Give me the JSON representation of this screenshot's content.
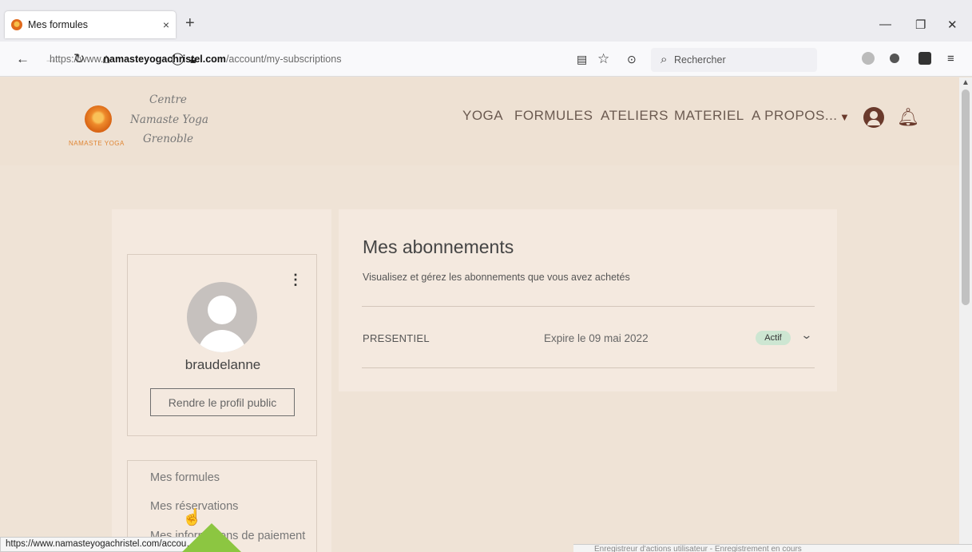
{
  "browser": {
    "tab_title": "Mes formules",
    "tab_close": "×",
    "new_tab": "+",
    "url_prefix": "https://www.",
    "url_domain": "namasteyogachristel.com",
    "url_path": "/account/my-subscriptions",
    "search_placeholder": "Rechercher",
    "status_url": "https://www.namasteyogachristel.com/accou…ings"
  },
  "site": {
    "logo_caption": "NAMASTE YOGA",
    "brand_line1": "Centre",
    "brand_line2": "Namaste Yoga",
    "brand_line3": "Grenoble",
    "nav": [
      "YOGA",
      "FORMULES",
      "ATELIERS",
      "MATERIEL",
      "A PROPOS..."
    ]
  },
  "profile": {
    "username": "braudelanne",
    "public_button": "Rendre le profil public"
  },
  "menu": [
    "Mes formules",
    "Mes réservations",
    "Mes informations de paiement"
  ],
  "subscriptions": {
    "title": "Mes abonnements",
    "subtitle": "Visualisez et gérez les abonnements que vous avez achetés",
    "items": [
      {
        "name": "PRESENTIEL",
        "expiry": "Expire le 09 mai 2022",
        "status": "Actif"
      }
    ]
  },
  "recorder": {
    "text": "Enregistreur d'actions utilisateur - Enregistrement en cours"
  },
  "colors": {
    "accent_brown": "#6a3a2c",
    "badge_green": "#cde6d2",
    "arrow_green": "#8cc641"
  }
}
